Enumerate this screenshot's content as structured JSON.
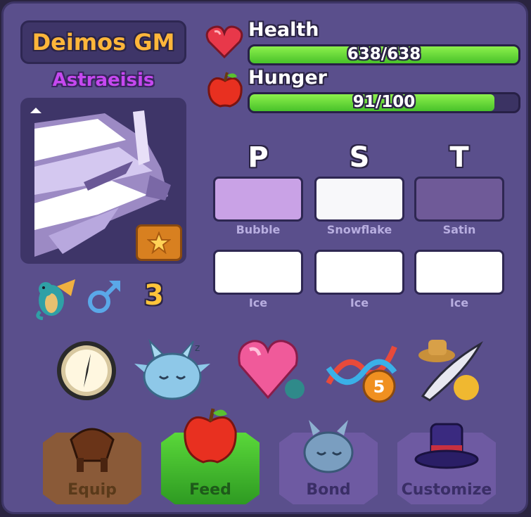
{
  "pet": {
    "name": "Deimos GM",
    "species": "Astraeisis",
    "level": "3"
  },
  "stats": {
    "health": {
      "label": "Health",
      "value": "638/638",
      "fraction": 1.0
    },
    "hunger": {
      "label": "Hunger",
      "value": "91/100",
      "fraction": 0.91
    }
  },
  "traits": {
    "columns": [
      "P",
      "S",
      "T"
    ],
    "row1": [
      {
        "name": "Bubble",
        "color": "#c9a2e6"
      },
      {
        "name": "Snowflake",
        "color": "#f8f8fa"
      },
      {
        "name": "Satin",
        "color": "#6f5a98"
      }
    ],
    "row2": [
      {
        "name": "Ice",
        "color": "#ffffff"
      },
      {
        "name": "Ice",
        "color": "#ffffff"
      },
      {
        "name": "Ice",
        "color": "#ffffff"
      }
    ]
  },
  "icons": {
    "meta": [
      "dragon-icon",
      "male-symbol-icon"
    ],
    "row": [
      "compass-icon",
      "sleeping-pet-icon",
      "heart-gem-icon",
      "dna-badge-icon",
      "feather-hat-icon"
    ],
    "dna_badge": "5"
  },
  "actions": [
    {
      "label": "Equip",
      "icon": "saddle-icon",
      "active": false
    },
    {
      "label": "Feed",
      "icon": "apple-icon",
      "active": true
    },
    {
      "label": "Bond",
      "icon": "sleeping-pet-icon",
      "active": false
    },
    {
      "label": "Customize",
      "icon": "top-hat-icon",
      "active": false
    }
  ],
  "colors": {
    "panel": "#5a4f8c",
    "name_text": "#ffb63a",
    "species_text": "#c648f0",
    "bar_fill": "#6ad83a"
  }
}
